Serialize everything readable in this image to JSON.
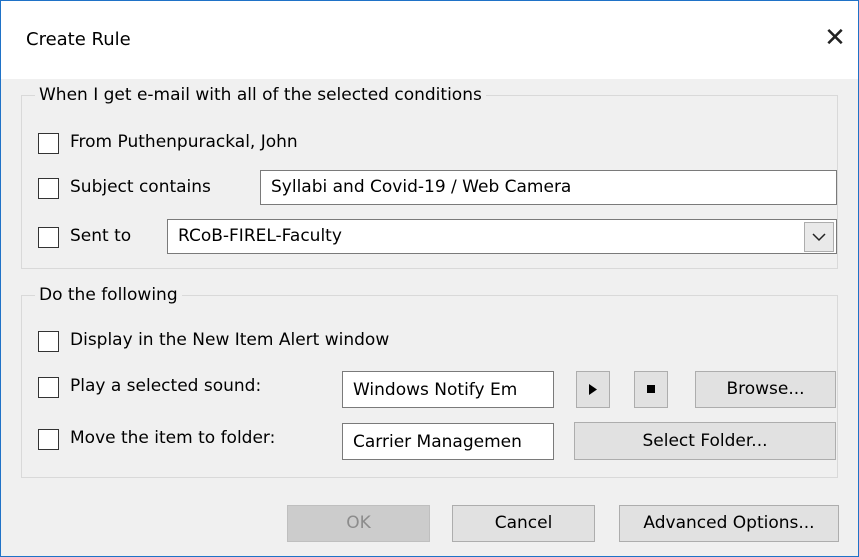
{
  "dialog": {
    "title": "Create Rule",
    "close_glyph": "✕"
  },
  "conditions": {
    "legend": "When I get e-mail with all of the selected conditions",
    "from": {
      "label": "From Puthenpurackal, John",
      "checked": false
    },
    "subject": {
      "label": "Subject contains",
      "value": "Syllabi and Covid-19 / Web Camera",
      "checked": false
    },
    "sent_to": {
      "label": "Sent to",
      "value": "RCoB-FIREL-Faculty",
      "checked": false
    }
  },
  "actions": {
    "legend": "Do the following",
    "alert": {
      "label": "Display in the New Item Alert window",
      "checked": false
    },
    "sound": {
      "label": "Play a selected sound:",
      "value": "Windows Notify Em",
      "browse_label": "Browse...",
      "checked": false
    },
    "move": {
      "label": "Move the item to folder:",
      "value": "Carrier Managemen",
      "select_folder_label": "Select Folder...",
      "checked": false
    }
  },
  "footer": {
    "ok_label": "OK",
    "cancel_label": "Cancel",
    "advanced_label": "Advanced Options..."
  }
}
